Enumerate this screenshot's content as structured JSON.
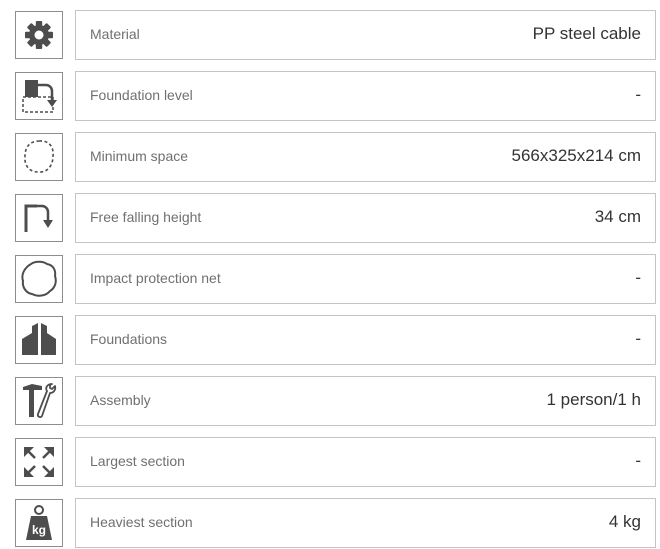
{
  "specs": [
    {
      "icon": "gear-icon",
      "label": "Material",
      "value": "PP steel cable"
    },
    {
      "icon": "foundation-level-icon",
      "label": "Foundation level",
      "value": "-"
    },
    {
      "icon": "minimum-space-icon",
      "label": "Minimum space",
      "value": "566x325x214 cm"
    },
    {
      "icon": "fall-height-icon",
      "label": "Free falling height",
      "value": "34 cm"
    },
    {
      "icon": "impact-net-icon",
      "label": "Impact protection net",
      "value": "-"
    },
    {
      "icon": "foundations-icon",
      "label": "Foundations",
      "value": "-"
    },
    {
      "icon": "tools-icon",
      "label": "Assembly",
      "value": "1 person/1 h"
    },
    {
      "icon": "expand-arrows-icon",
      "label": "Largest section",
      "value": "-"
    },
    {
      "icon": "weight-icon",
      "label": "Heaviest section",
      "value": "4 kg",
      "icon_text": "kg"
    }
  ],
  "colors": {
    "icon_fill": "#4d4d4d",
    "icon_border": "#8d8d8d",
    "row_border": "#c4c4c4"
  }
}
